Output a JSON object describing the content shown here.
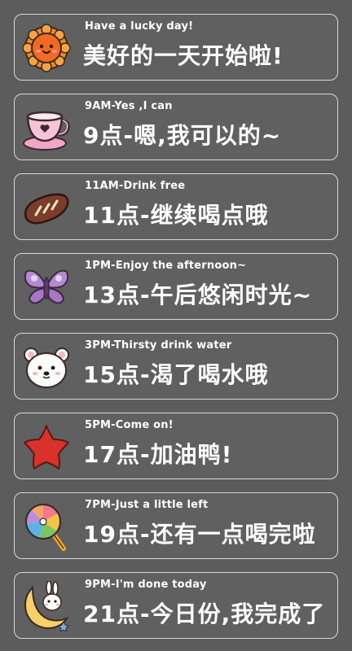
{
  "items": [
    {
      "en": "Have a lucky day!",
      "zh": "美好的一天开始啦!",
      "icon": "sun-icon"
    },
    {
      "en": "9AM-Yes ,I can",
      "zh": "9点-嗯,我可以的~",
      "icon": "teacup-icon"
    },
    {
      "en": "11AM-Drink free",
      "zh": "11点-继续喝点哦",
      "icon": "bread-icon"
    },
    {
      "en": "1PM-Enjoy the afternoon~",
      "zh": "13点-午后悠闲时光~",
      "icon": "butterfly-icon"
    },
    {
      "en": "3PM-Thirsty drink water",
      "zh": "15点-渴了喝水哦",
      "icon": "bear-icon"
    },
    {
      "en": "5PM-Come on!",
      "zh": "17点-加油鸭!",
      "icon": "star-icon"
    },
    {
      "en": "7PM-Just a little left",
      "zh": "19点-还有一点喝完啦",
      "icon": "lollipop-icon"
    },
    {
      "en": "9PM-I'm done today",
      "zh": "21点-今日份,我完成了",
      "icon": "moon-bunny-icon"
    }
  ],
  "colors": {
    "background": "#5b5c5b",
    "card_border": "#d9d9d9",
    "text": "#ffffff"
  }
}
